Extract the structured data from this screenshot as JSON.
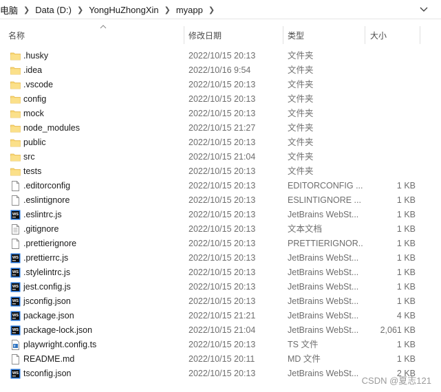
{
  "breadcrumb": {
    "items": [
      "电脑",
      "Data (D:)",
      "YongHuZhongXin",
      "myapp"
    ]
  },
  "columns": {
    "name": "名称",
    "date": "修改日期",
    "type": "类型",
    "size": "大小"
  },
  "files": [
    {
      "name": ".husky",
      "date": "2022/10/15 20:13",
      "type": "文件夹",
      "size": "",
      "icon": "folder"
    },
    {
      "name": ".idea",
      "date": "2022/10/16 9:54",
      "type": "文件夹",
      "size": "",
      "icon": "folder"
    },
    {
      "name": ".vscode",
      "date": "2022/10/15 20:13",
      "type": "文件夹",
      "size": "",
      "icon": "folder"
    },
    {
      "name": "config",
      "date": "2022/10/15 20:13",
      "type": "文件夹",
      "size": "",
      "icon": "folder"
    },
    {
      "name": "mock",
      "date": "2022/10/15 20:13",
      "type": "文件夹",
      "size": "",
      "icon": "folder"
    },
    {
      "name": "node_modules",
      "date": "2022/10/15 21:27",
      "type": "文件夹",
      "size": "",
      "icon": "folder"
    },
    {
      "name": "public",
      "date": "2022/10/15 20:13",
      "type": "文件夹",
      "size": "",
      "icon": "folder"
    },
    {
      "name": "src",
      "date": "2022/10/15 21:04",
      "type": "文件夹",
      "size": "",
      "icon": "folder"
    },
    {
      "name": "tests",
      "date": "2022/10/15 20:13",
      "type": "文件夹",
      "size": "",
      "icon": "folder"
    },
    {
      "name": ".editorconfig",
      "date": "2022/10/15 20:13",
      "type": "EDITORCONFIG ...",
      "size": "1 KB",
      "icon": "file"
    },
    {
      "name": ".eslintignore",
      "date": "2022/10/15 20:13",
      "type": "ESLINTIGNORE ...",
      "size": "1 KB",
      "icon": "file"
    },
    {
      "name": ".eslintrc.js",
      "date": "2022/10/15 20:13",
      "type": "JetBrains WebSt...",
      "size": "1 KB",
      "icon": "webstorm"
    },
    {
      "name": ".gitignore",
      "date": "2022/10/15 20:13",
      "type": "文本文档",
      "size": "1 KB",
      "icon": "text"
    },
    {
      "name": ".prettierignore",
      "date": "2022/10/15 20:13",
      "type": "PRETTIERIGNOR...",
      "size": "1 KB",
      "icon": "file"
    },
    {
      "name": ".prettierrc.js",
      "date": "2022/10/15 20:13",
      "type": "JetBrains WebSt...",
      "size": "1 KB",
      "icon": "webstorm"
    },
    {
      "name": ".stylelintrc.js",
      "date": "2022/10/15 20:13",
      "type": "JetBrains WebSt...",
      "size": "1 KB",
      "icon": "webstorm"
    },
    {
      "name": "jest.config.js",
      "date": "2022/10/15 20:13",
      "type": "JetBrains WebSt...",
      "size": "1 KB",
      "icon": "webstorm"
    },
    {
      "name": "jsconfig.json",
      "date": "2022/10/15 20:13",
      "type": "JetBrains WebSt...",
      "size": "1 KB",
      "icon": "webstorm"
    },
    {
      "name": "package.json",
      "date": "2022/10/15 21:21",
      "type": "JetBrains WebSt...",
      "size": "4 KB",
      "icon": "webstorm"
    },
    {
      "name": "package-lock.json",
      "date": "2022/10/15 21:04",
      "type": "JetBrains WebSt...",
      "size": "2,061 KB",
      "icon": "webstorm"
    },
    {
      "name": "playwright.config.ts",
      "date": "2022/10/15 20:13",
      "type": "TS 文件",
      "size": "1 KB",
      "icon": "ts"
    },
    {
      "name": "README.md",
      "date": "2022/10/15 20:11",
      "type": "MD 文件",
      "size": "1 KB",
      "icon": "file"
    },
    {
      "name": "tsconfig.json",
      "date": "2022/10/15 20:13",
      "type": "JetBrains WebSt...",
      "size": "2 KB",
      "icon": "webstorm"
    }
  ],
  "watermark": "CSDN @夏志121",
  "colors": {
    "folder": "#f8d775",
    "folder_dark": "#e8b84a",
    "webstorm_bg": "#111111",
    "ts_blue": "#2f74c0"
  }
}
